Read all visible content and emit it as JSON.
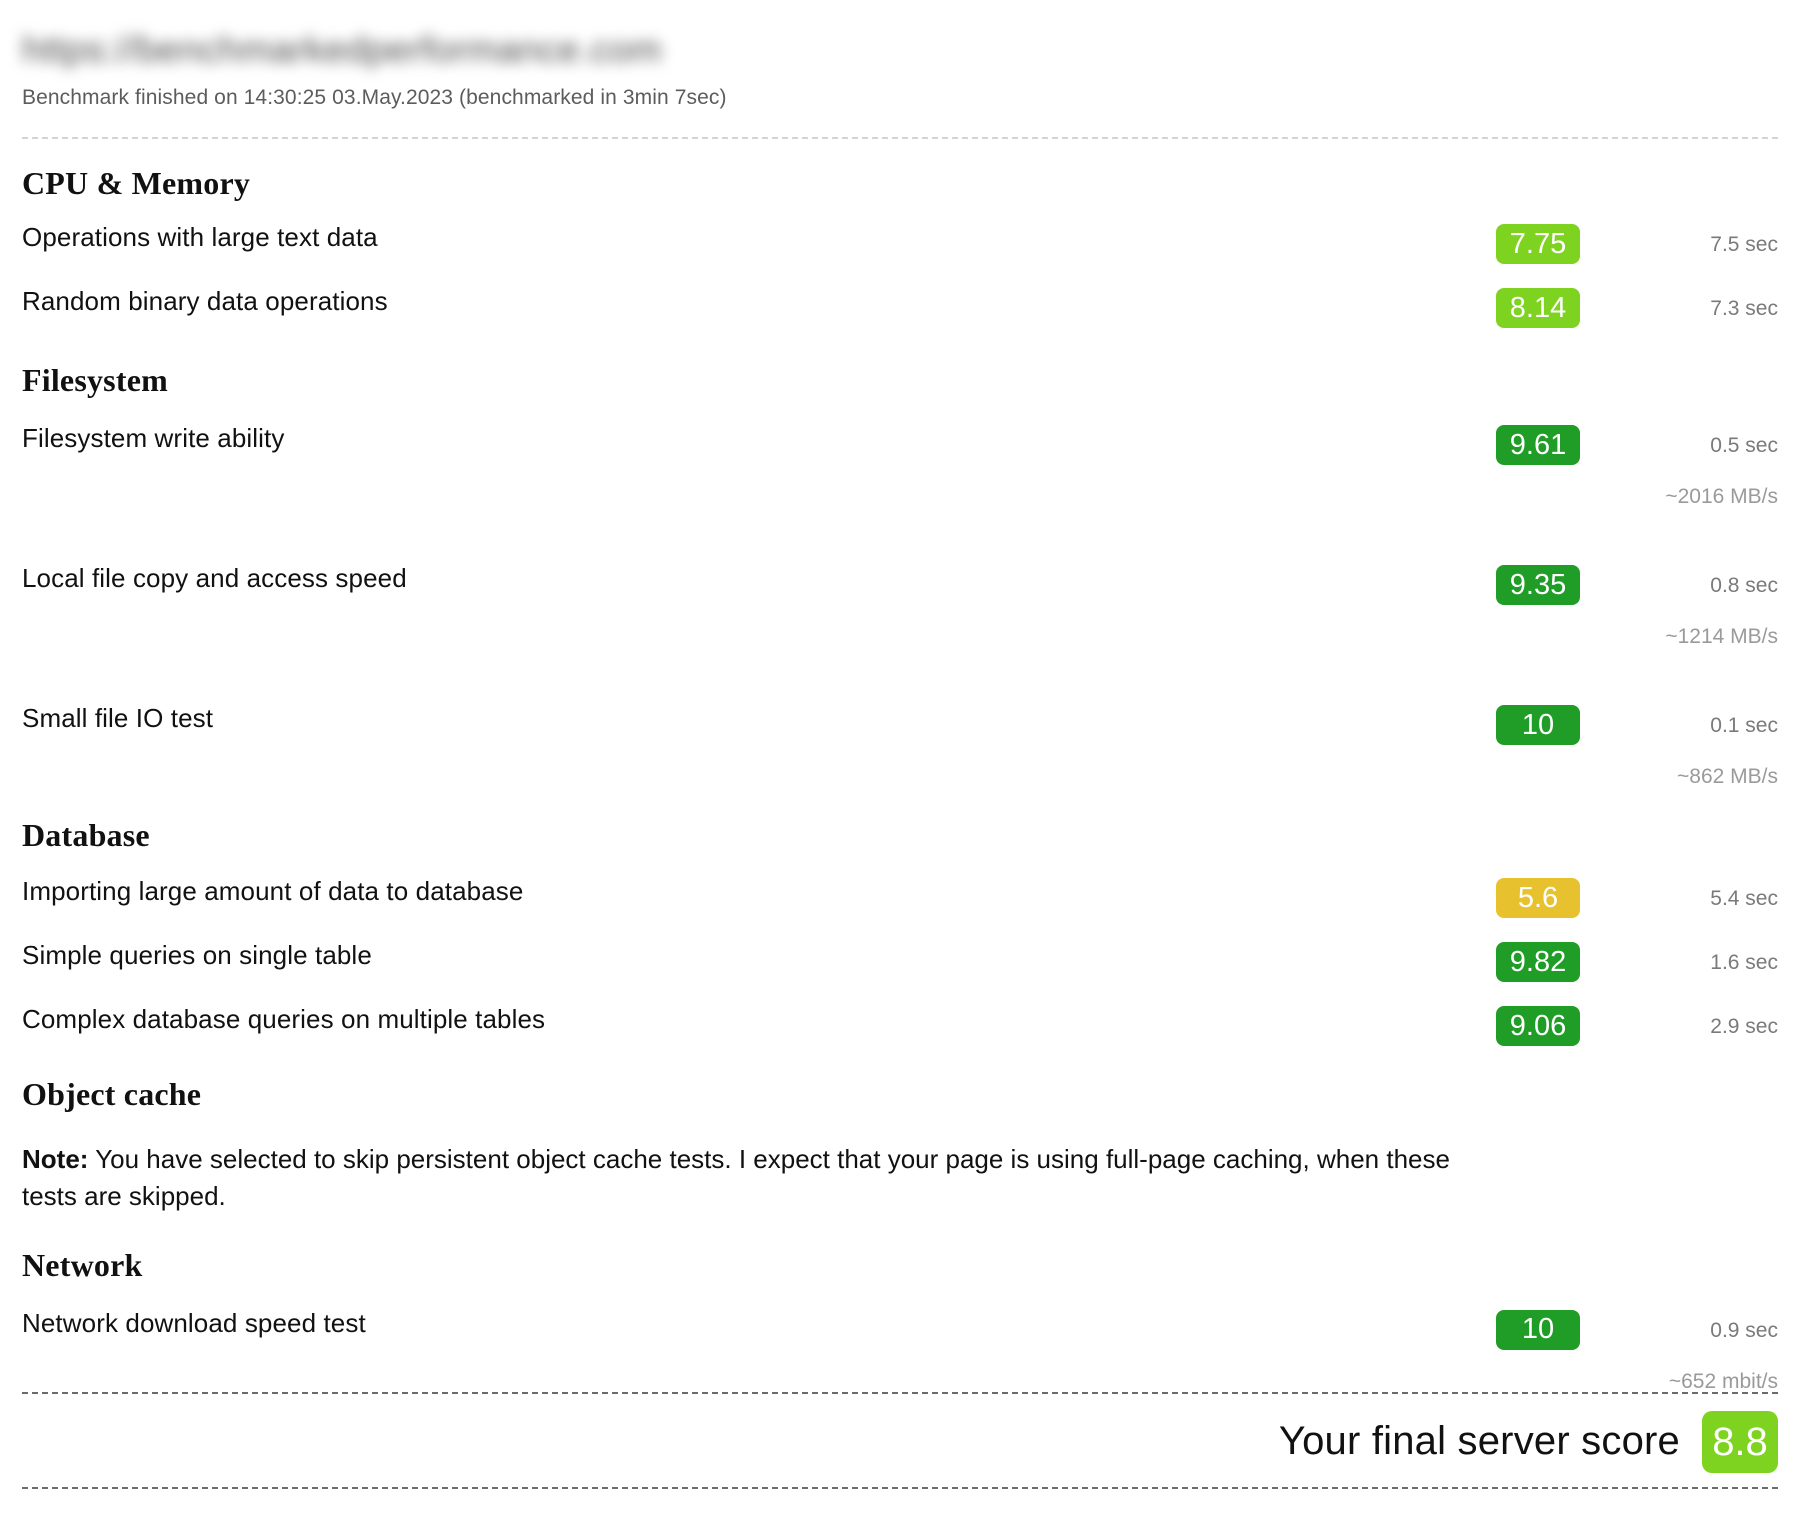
{
  "header": {
    "url": "https://benchmarkedperformance.com",
    "meta": "Benchmark finished on 14:30:25 03.May.2023 (benchmarked in 3min 7sec)"
  },
  "colors": {
    "light_green": "#7ed321",
    "green": "#1f9d27",
    "yellow": "#e8c22e"
  },
  "sections": [
    {
      "title": "CPU & Memory",
      "rows": [
        {
          "label": "Operations with large text data",
          "score": "7.75",
          "tone": "lightgreen",
          "time": "7.5 sec",
          "throughput": ""
        },
        {
          "label": "Random binary data operations",
          "score": "8.14",
          "tone": "lightgreen",
          "time": "7.3 sec",
          "throughput": ""
        }
      ]
    },
    {
      "title": "Filesystem",
      "rows": [
        {
          "label": "Filesystem write ability",
          "score": "9.61",
          "tone": "green",
          "time": "0.5 sec",
          "throughput": "~2016 MB/s"
        },
        {
          "label": "Local file copy and access speed",
          "score": "9.35",
          "tone": "green",
          "time": "0.8 sec",
          "throughput": "~1214 MB/s"
        },
        {
          "label": "Small file IO test",
          "score": "10",
          "tone": "green",
          "time": "0.1 sec",
          "throughput": "~862 MB/s"
        }
      ]
    },
    {
      "title": "Database",
      "rows": [
        {
          "label": "Importing large amount of data to database",
          "score": "5.6",
          "tone": "yellow",
          "time": "5.4 sec",
          "throughput": ""
        },
        {
          "label": "Simple queries on single table",
          "score": "9.82",
          "tone": "green",
          "time": "1.6 sec",
          "throughput": ""
        },
        {
          "label": "Complex database queries on multiple tables",
          "score": "9.06",
          "tone": "green",
          "time": "2.9 sec",
          "throughput": ""
        }
      ]
    },
    {
      "title": "Object cache",
      "note_label": "Note:",
      "note_text": " You have selected to skip persistent object cache tests. I expect that your page is using full-page caching, when these tests are skipped.",
      "rows": []
    },
    {
      "title": "Network",
      "rows": [
        {
          "label": "Network download speed test",
          "score": "10",
          "tone": "green",
          "time": "0.9 sec",
          "throughput": "~652 mbit/s"
        }
      ]
    }
  ],
  "final": {
    "label": "Your final server score",
    "score": "8.8",
    "tone": "lightgreen"
  }
}
